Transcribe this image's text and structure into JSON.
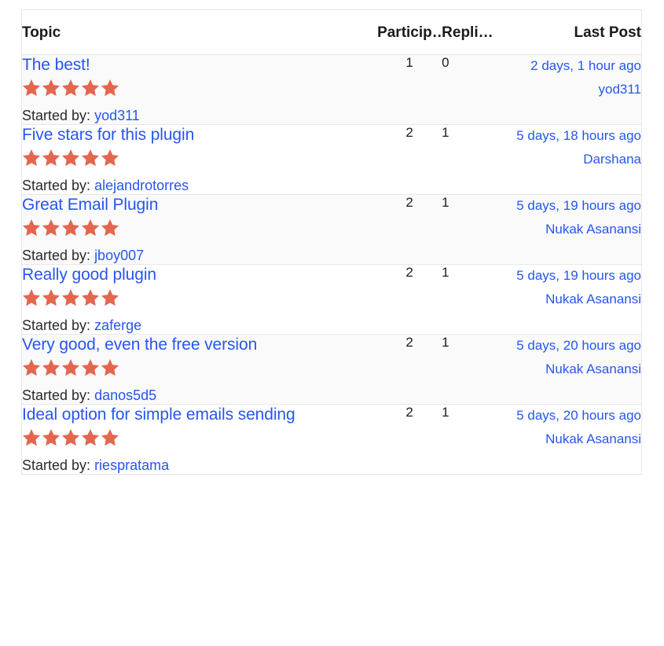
{
  "table": {
    "headers": {
      "topic": "Topic",
      "voices": "Particip…",
      "replies": "Repli…",
      "freshness": "Last Post"
    },
    "started_by_label": "Started by:",
    "colors": {
      "link": "#2756f0",
      "star": "#e4664f",
      "border": "#e6e6e6",
      "row_stripe": "#fafafa",
      "text": "#1c1c1c"
    },
    "rows": [
      {
        "title": "The best!",
        "rating": 5,
        "author": "yod311",
        "voices": "1",
        "replies": "0",
        "freshness_time": "2 days, 1 hour ago",
        "freshness_author": "yod311"
      },
      {
        "title": "Five stars for this plugin",
        "rating": 5,
        "author": "alejandrotorres",
        "voices": "2",
        "replies": "1",
        "freshness_time": "5 days, 18 hours ago",
        "freshness_author": "Darshana"
      },
      {
        "title": "Great Email Plugin",
        "rating": 5,
        "author": "jboy007",
        "voices": "2",
        "replies": "1",
        "freshness_time": "5 days, 19 hours ago",
        "freshness_author": "Nukak Asanansi"
      },
      {
        "title": "Really good plugin",
        "rating": 5,
        "author": "zaferge",
        "voices": "2",
        "replies": "1",
        "freshness_time": "5 days, 19 hours ago",
        "freshness_author": "Nukak Asanansi"
      },
      {
        "title": "Very good, even the free version",
        "rating": 5,
        "author": "danos5d5",
        "voices": "2",
        "replies": "1",
        "freshness_time": "5 days, 20 hours ago",
        "freshness_author": "Nukak Asanansi"
      },
      {
        "title": "Ideal option for simple emails sending",
        "rating": 5,
        "author": "riespratama",
        "voices": "2",
        "replies": "1",
        "freshness_time": "5 days, 20 hours ago",
        "freshness_author": "Nukak Asanansi"
      }
    ]
  }
}
